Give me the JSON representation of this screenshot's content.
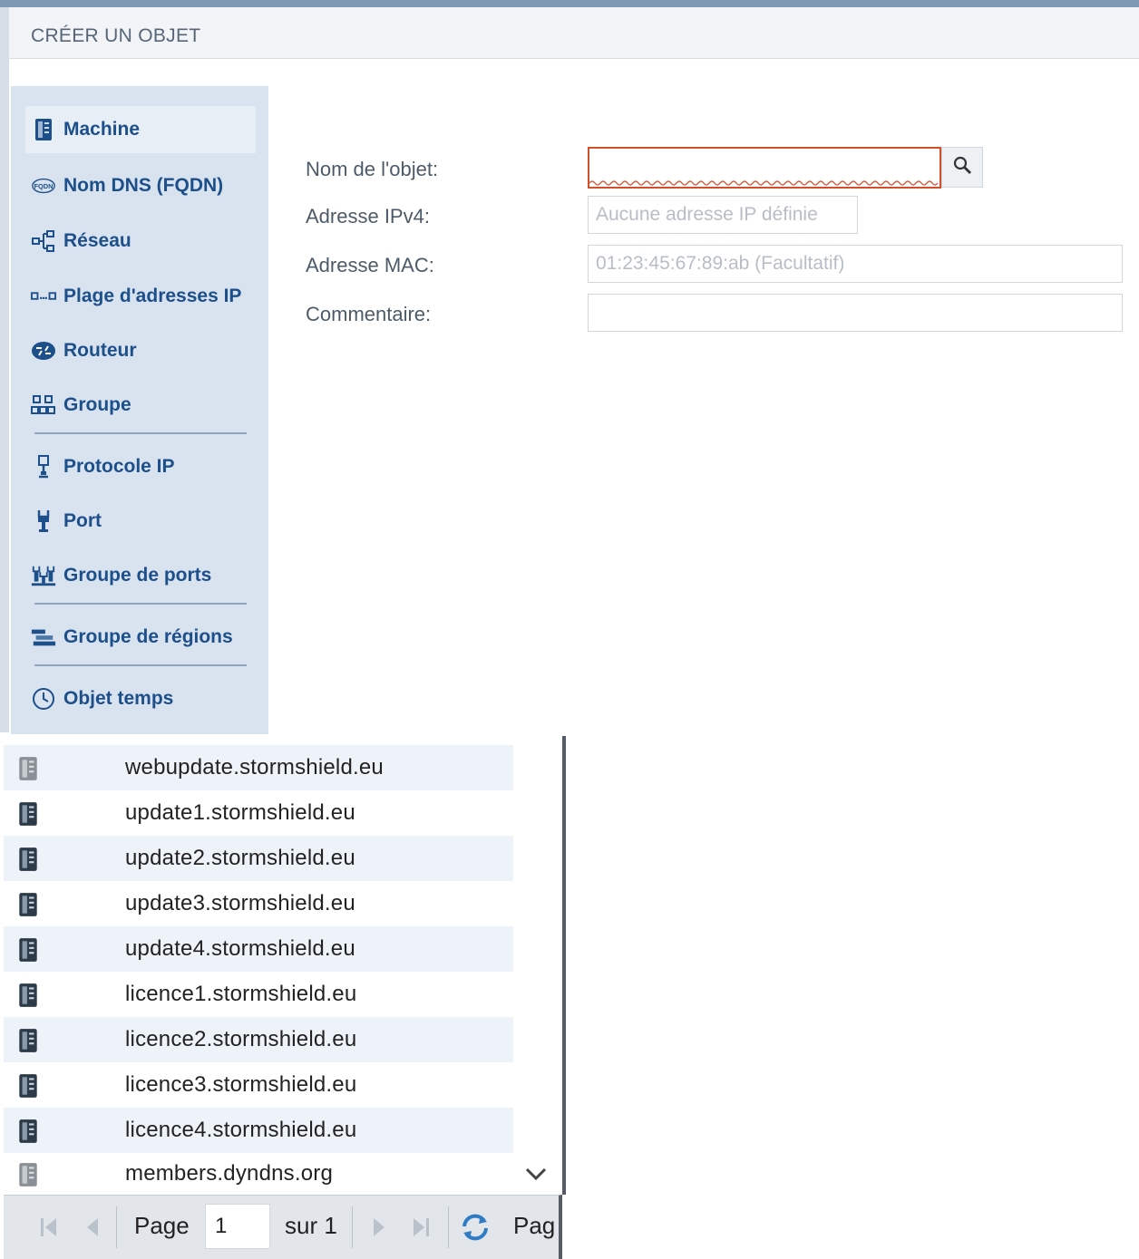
{
  "header": {
    "title": "CRÉER UN OBJET"
  },
  "sidebar": {
    "items": [
      {
        "label": "Machine",
        "icon": "server-icon",
        "selected": true
      },
      {
        "label": "Nom DNS (FQDN)",
        "icon": "fqdn-icon",
        "selected": false
      },
      {
        "label": "Réseau",
        "icon": "network-icon",
        "selected": false
      },
      {
        "label": "Plage d'adresses IP",
        "icon": "ip-range-icon",
        "selected": false
      },
      {
        "label": "Routeur",
        "icon": "router-icon",
        "selected": false
      },
      {
        "label": "Groupe",
        "icon": "group-icon",
        "selected": false
      },
      {
        "label": "Protocole IP",
        "icon": "protocol-icon",
        "selected": false
      },
      {
        "label": "Port",
        "icon": "port-icon",
        "selected": false
      },
      {
        "label": "Groupe de ports",
        "icon": "port-group-icon",
        "selected": false
      },
      {
        "label": "Groupe de régions",
        "icon": "region-group-icon",
        "selected": false
      },
      {
        "label": "Objet temps",
        "icon": "clock-icon",
        "selected": false
      }
    ]
  },
  "form": {
    "name_label": "Nom de l'objet:",
    "name_value": "",
    "ipv4_label": "Adresse IPv4:",
    "ipv4_placeholder": "Aucune adresse IP définie",
    "mac_label": "Adresse MAC:",
    "mac_placeholder": "01:23:45:67:89:ab (Facultatif)",
    "comment_label": "Commentaire:",
    "comment_value": ""
  },
  "list": {
    "items": [
      "webupdate.stormshield.eu",
      "update1.stormshield.eu",
      "update2.stormshield.eu",
      "update3.stormshield.eu",
      "update4.stormshield.eu",
      "licence1.stormshield.eu",
      "licence2.stormshield.eu",
      "licence3.stormshield.eu",
      "licence4.stormshield.eu",
      "members.dyndns.org"
    ]
  },
  "pager": {
    "page_label": "Page",
    "page_value": "1",
    "of_label": "sur 1",
    "trailing_label": "Pag"
  },
  "colors": {
    "sidebar_bg": "#d9e3ef",
    "link_blue": "#1d4f8a",
    "error_red": "#d24f2c",
    "row_alt": "#eef3fa"
  }
}
